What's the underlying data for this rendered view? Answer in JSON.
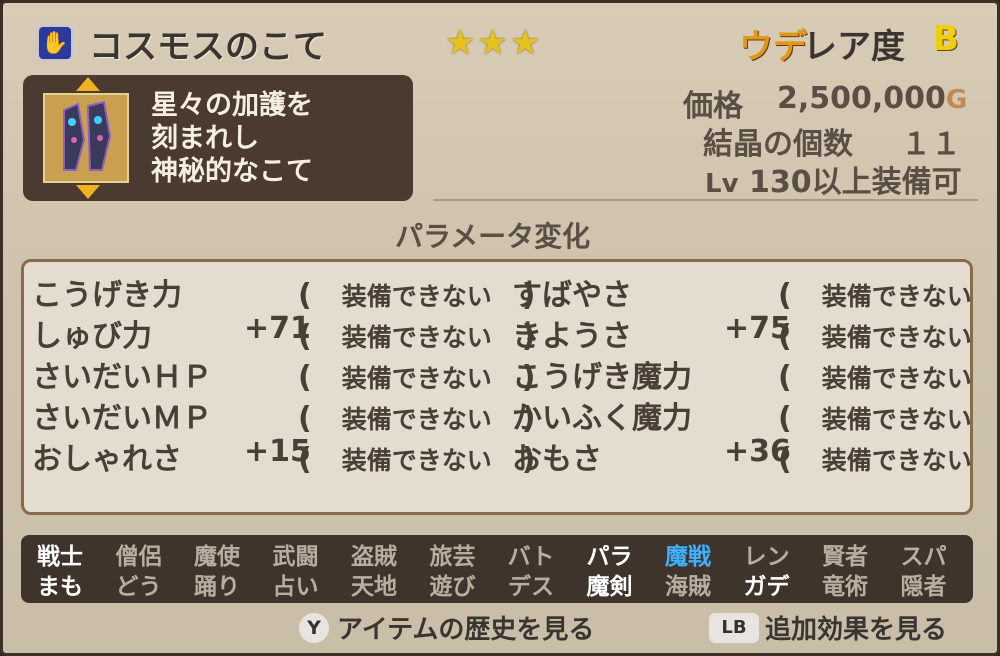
{
  "item": {
    "name": "コスモスのこて",
    "stars": "★★★",
    "rarity_icon": "ウデ",
    "rarity_label": "レア度",
    "rarity_grade": "B",
    "description": [
      "星々の加護を",
      "刻まれし",
      "神秘的なこて"
    ]
  },
  "info": {
    "price_label": "価格",
    "price_value": "2,500,000",
    "price_unit": "G",
    "crystal_label": "結晶の個数",
    "crystal_value": "１１",
    "level_prefix": "Lv",
    "level_value": "130",
    "level_suffix": "以上装備可"
  },
  "params": {
    "title": "パラメータ変化",
    "cannot_equip": "装備できない",
    "left": [
      {
        "name": "こうげき力",
        "value": ""
      },
      {
        "name": "しゅび力",
        "value": "+71"
      },
      {
        "name": "さいだいＨＰ",
        "value": ""
      },
      {
        "name": "さいだいＭＰ",
        "value": ""
      },
      {
        "name": "おしゃれさ",
        "value": "+15"
      }
    ],
    "right": [
      {
        "name": "すばやさ",
        "value": ""
      },
      {
        "name": "きようさ",
        "value": "+75"
      },
      {
        "name": "こうげき魔力",
        "value": ""
      },
      {
        "name": "かいふく魔力",
        "value": ""
      },
      {
        "name": "おもさ",
        "value": "+36"
      }
    ]
  },
  "jobs": {
    "row1": [
      "戦士",
      "僧侶",
      "魔使",
      "武闘",
      "盗賊",
      "旅芸",
      "バト",
      "パラ",
      "魔戦",
      "レン",
      "賢者",
      "スパ"
    ],
    "row2": [
      "まも",
      "どう",
      "踊り",
      "占い",
      "天地",
      "遊び",
      "デス",
      "魔剣",
      "海賊",
      "ガデ",
      "竜術",
      "隠者"
    ],
    "row1_state": [
      "on",
      "off",
      "off",
      "off",
      "off",
      "off",
      "off",
      "on",
      "sel",
      "off",
      "off",
      "off"
    ],
    "row2_state": [
      "on",
      "off",
      "off",
      "off",
      "off",
      "off",
      "off",
      "on",
      "off",
      "on",
      "off",
      "off"
    ]
  },
  "footer": {
    "y_button": "Y",
    "y_label": "アイテムの歴史を見る",
    "lb_button": "LB",
    "lb_label": "追加効果を見る"
  },
  "colors": {
    "background": "#cfc3ad",
    "panel_dark": "#4a3a30",
    "gold": "#e8c21c",
    "selected_job": "#40b0ff"
  }
}
